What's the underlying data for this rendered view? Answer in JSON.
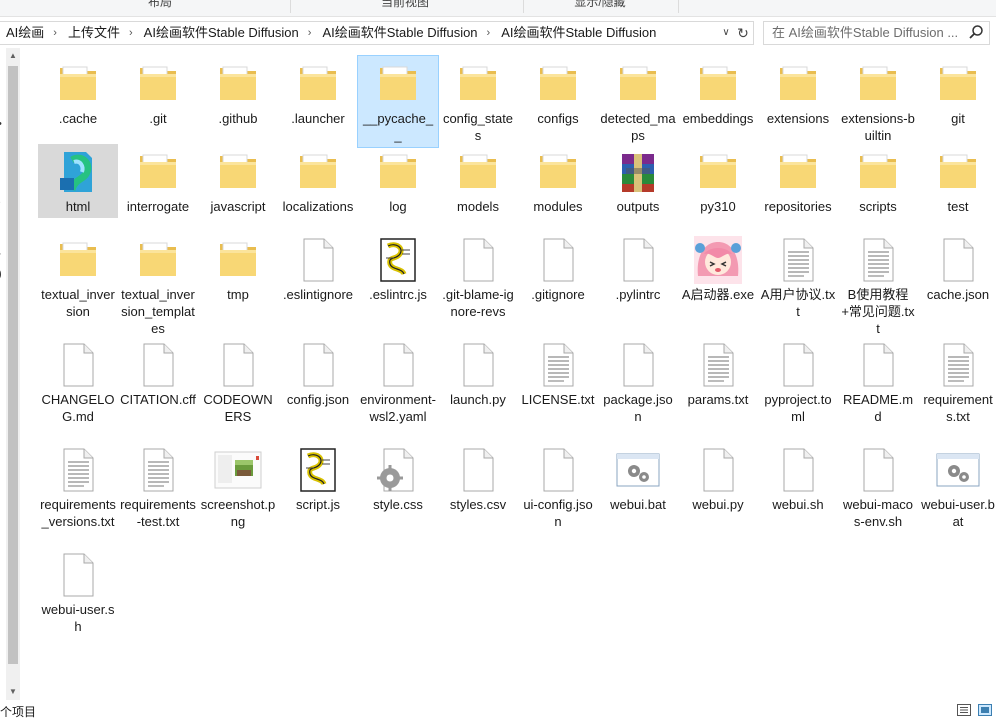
{
  "ribbon": {
    "groups": [
      "布局",
      "当前视图",
      "显示/隐藏"
    ]
  },
  "address": {
    "crumbs": [
      "AI绘画",
      "上传文件",
      "AI绘画软件Stable Diffusion",
      "AI绘画软件Stable Diffusion",
      "AI绘画软件Stable Diffusion"
    ]
  },
  "search": {
    "placeholder": "在 AI绘画软件Stable Diffusion ..."
  },
  "items": [
    {
      "label": ".cache",
      "icon": "folder-icon"
    },
    {
      "label": ".git",
      "icon": "folder-icon"
    },
    {
      "label": ".github",
      "icon": "folder-icon"
    },
    {
      "label": ".launcher",
      "icon": "folder-icon"
    },
    {
      "label": "__pycache__",
      "icon": "folder-icon"
    },
    {
      "label": "config_states",
      "icon": "folder-icon"
    },
    {
      "label": "configs",
      "icon": "folder-icon"
    },
    {
      "label": "detected_maps",
      "icon": "folder-icon"
    },
    {
      "label": "embeddings",
      "icon": "folder-icon"
    },
    {
      "label": "extensions",
      "icon": "folder-icon"
    },
    {
      "label": "extensions-builtin",
      "icon": "folder-icon"
    },
    {
      "label": "git",
      "icon": "folder-icon"
    },
    {
      "label": "html",
      "icon": "browser-app-icon"
    },
    {
      "label": "interrogate",
      "icon": "folder-icon"
    },
    {
      "label": "javascript",
      "icon": "folder-icon"
    },
    {
      "label": "localizations",
      "icon": "folder-icon"
    },
    {
      "label": "log",
      "icon": "folder-icon"
    },
    {
      "label": "models",
      "icon": "folder-icon"
    },
    {
      "label": "modules",
      "icon": "folder-icon"
    },
    {
      "label": "outputs",
      "icon": "archive-icon"
    },
    {
      "label": "py310",
      "icon": "folder-icon"
    },
    {
      "label": "repositories",
      "icon": "folder-icon"
    },
    {
      "label": "scripts",
      "icon": "folder-icon"
    },
    {
      "label": "test",
      "icon": "folder-icon"
    },
    {
      "label": "textual_inversion",
      "icon": "folder-icon"
    },
    {
      "label": "textual_inversion_templates",
      "icon": "folder-icon"
    },
    {
      "label": "tmp",
      "icon": "folder-icon"
    },
    {
      "label": ".eslintignore",
      "icon": "blank-file-icon"
    },
    {
      "label": ".eslintrc.js",
      "icon": "script-file-icon"
    },
    {
      "label": ".git-blame-ignore-revs",
      "icon": "blank-file-icon"
    },
    {
      "label": ".gitignore",
      "icon": "blank-file-icon"
    },
    {
      "label": ".pylintrc",
      "icon": "blank-file-icon"
    },
    {
      "label": "A启动器.exe",
      "icon": "anime-avatar-icon"
    },
    {
      "label": "A用户协议.txt",
      "icon": "text-file-icon"
    },
    {
      "label": "B使用教程+常见问题.txt",
      "icon": "text-file-icon"
    },
    {
      "label": "cache.json",
      "icon": "blank-file-icon"
    },
    {
      "label": "CHANGELOG.md",
      "icon": "blank-file-icon"
    },
    {
      "label": "CITATION.cff",
      "icon": "blank-file-icon"
    },
    {
      "label": "CODEOWNERS",
      "icon": "blank-file-icon"
    },
    {
      "label": "config.json",
      "icon": "blank-file-icon"
    },
    {
      "label": "environment-wsl2.yaml",
      "icon": "blank-file-icon"
    },
    {
      "label": "launch.py",
      "icon": "blank-file-icon"
    },
    {
      "label": "LICENSE.txt",
      "icon": "text-file-icon"
    },
    {
      "label": "package.json",
      "icon": "blank-file-icon"
    },
    {
      "label": "params.txt",
      "icon": "text-file-icon"
    },
    {
      "label": "pyproject.toml",
      "icon": "blank-file-icon"
    },
    {
      "label": "README.md",
      "icon": "blank-file-icon"
    },
    {
      "label": "requirements.txt",
      "icon": "text-file-icon"
    },
    {
      "label": "requirements_versions.txt",
      "icon": "text-file-icon"
    },
    {
      "label": "requirements-test.txt",
      "icon": "text-file-icon"
    },
    {
      "label": "screenshot.png",
      "icon": "image-thumbnail-icon"
    },
    {
      "label": "script.js",
      "icon": "script-file-icon"
    },
    {
      "label": "style.css",
      "icon": "css-file-icon"
    },
    {
      "label": "styles.csv",
      "icon": "blank-file-icon"
    },
    {
      "label": "ui-config.json",
      "icon": "blank-file-icon"
    },
    {
      "label": "webui.bat",
      "icon": "batch-file-icon"
    },
    {
      "label": "webui.py",
      "icon": "blank-file-icon"
    },
    {
      "label": "webui.sh",
      "icon": "blank-file-icon"
    },
    {
      "label": "webui-macos-env.sh",
      "icon": "blank-file-icon"
    },
    {
      "label": "webui-user.bat",
      "icon": "batch-file-icon"
    },
    {
      "label": "webui-user.sh",
      "icon": "blank-file-icon"
    }
  ],
  "status": {
    "count": "个项目"
  },
  "colors": {
    "folder": "#f8d775",
    "selection": "#cce8ff",
    "hover": "#d9d9d9"
  }
}
